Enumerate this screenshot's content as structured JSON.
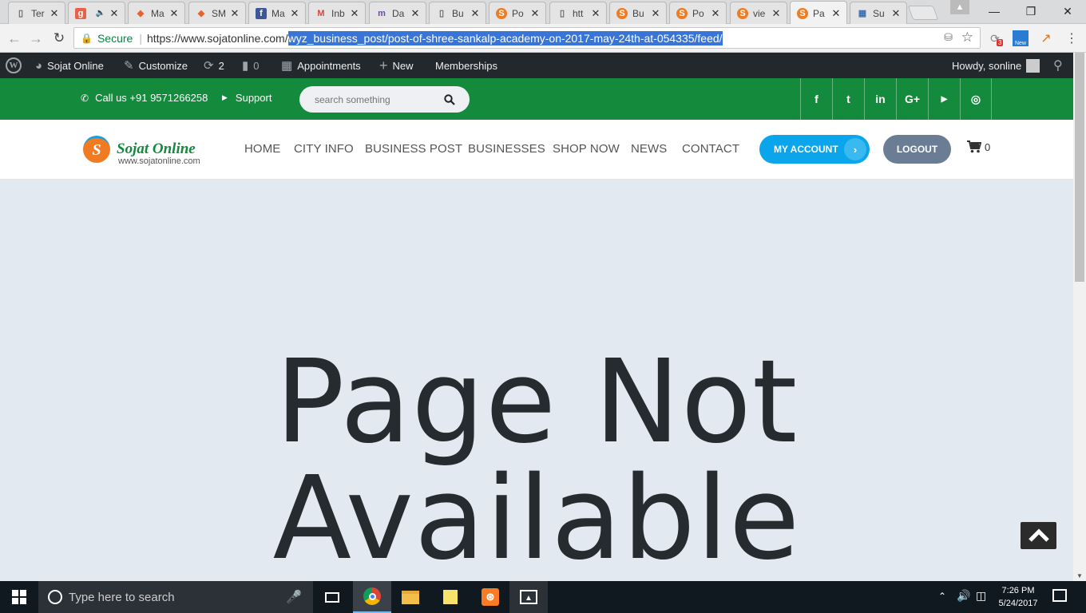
{
  "browser": {
    "tabs": [
      {
        "title": "Ter",
        "icon": "page-icon"
      },
      {
        "title": "",
        "icon": "g-icon"
      },
      {
        "title": "Ma",
        "icon": "magento-icon"
      },
      {
        "title": "SM",
        "icon": "magento-icon"
      },
      {
        "title": "Ma",
        "icon": "facebook-icon"
      },
      {
        "title": "Inb",
        "icon": "gmail-icon"
      },
      {
        "title": "Da",
        "icon": "m-icon"
      },
      {
        "title": "Bu",
        "icon": "page-icon"
      },
      {
        "title": "Po",
        "icon": "sojat-icon"
      },
      {
        "title": "htt",
        "icon": "page-icon"
      },
      {
        "title": "Bu",
        "icon": "sojat-icon"
      },
      {
        "title": "Po",
        "icon": "sojat-icon"
      },
      {
        "title": "vie",
        "icon": "sojat-icon"
      },
      {
        "title": "Pa",
        "icon": "sojat-icon"
      },
      {
        "title": "Su",
        "icon": "grid-icon"
      }
    ],
    "address": {
      "secure_label": "Secure",
      "url_host": "https://www.sojatonline.com/",
      "url_path": "wyz_business_post/post-of-shree-sankalp-academy-on-2017-may-24th-at-054335/feed/"
    },
    "ext_badge": "3",
    "ext_new": "New"
  },
  "adminbar": {
    "site_name": "Sojat Online",
    "customize": "Customize",
    "updates": "2",
    "comments": "0",
    "appointments": "Appointments",
    "new": "New",
    "memberships": "Memberships",
    "howdy": "Howdy, sonline"
  },
  "topbar": {
    "call": "Call us +91 9571266258",
    "support": "Support",
    "search_placeholder": "search something",
    "social": [
      "f",
      "t",
      "in",
      "G+",
      "▶",
      "◎"
    ]
  },
  "header": {
    "logo_title": "Sojat Online",
    "logo_sub": "www.sojatonline.com",
    "nav": [
      "HOME",
      "CITY INFO",
      "BUSINESS POST",
      "BUSINESSES",
      "SHOP NOW",
      "NEWS",
      "CONTACT"
    ],
    "my_account": "MY ACCOUNT",
    "logout": "LOGOUT",
    "cart_count": "0"
  },
  "main": {
    "heading_line1": "Page Not",
    "heading_line2": "Available"
  },
  "taskbar": {
    "search_placeholder": "Type here to search",
    "time": "7:26 PM",
    "date": "5/24/2017"
  },
  "colors": {
    "green": "#138a3c",
    "blue": "#0aa5ea",
    "slate": "#6b7d95",
    "admin": "#23282d"
  }
}
